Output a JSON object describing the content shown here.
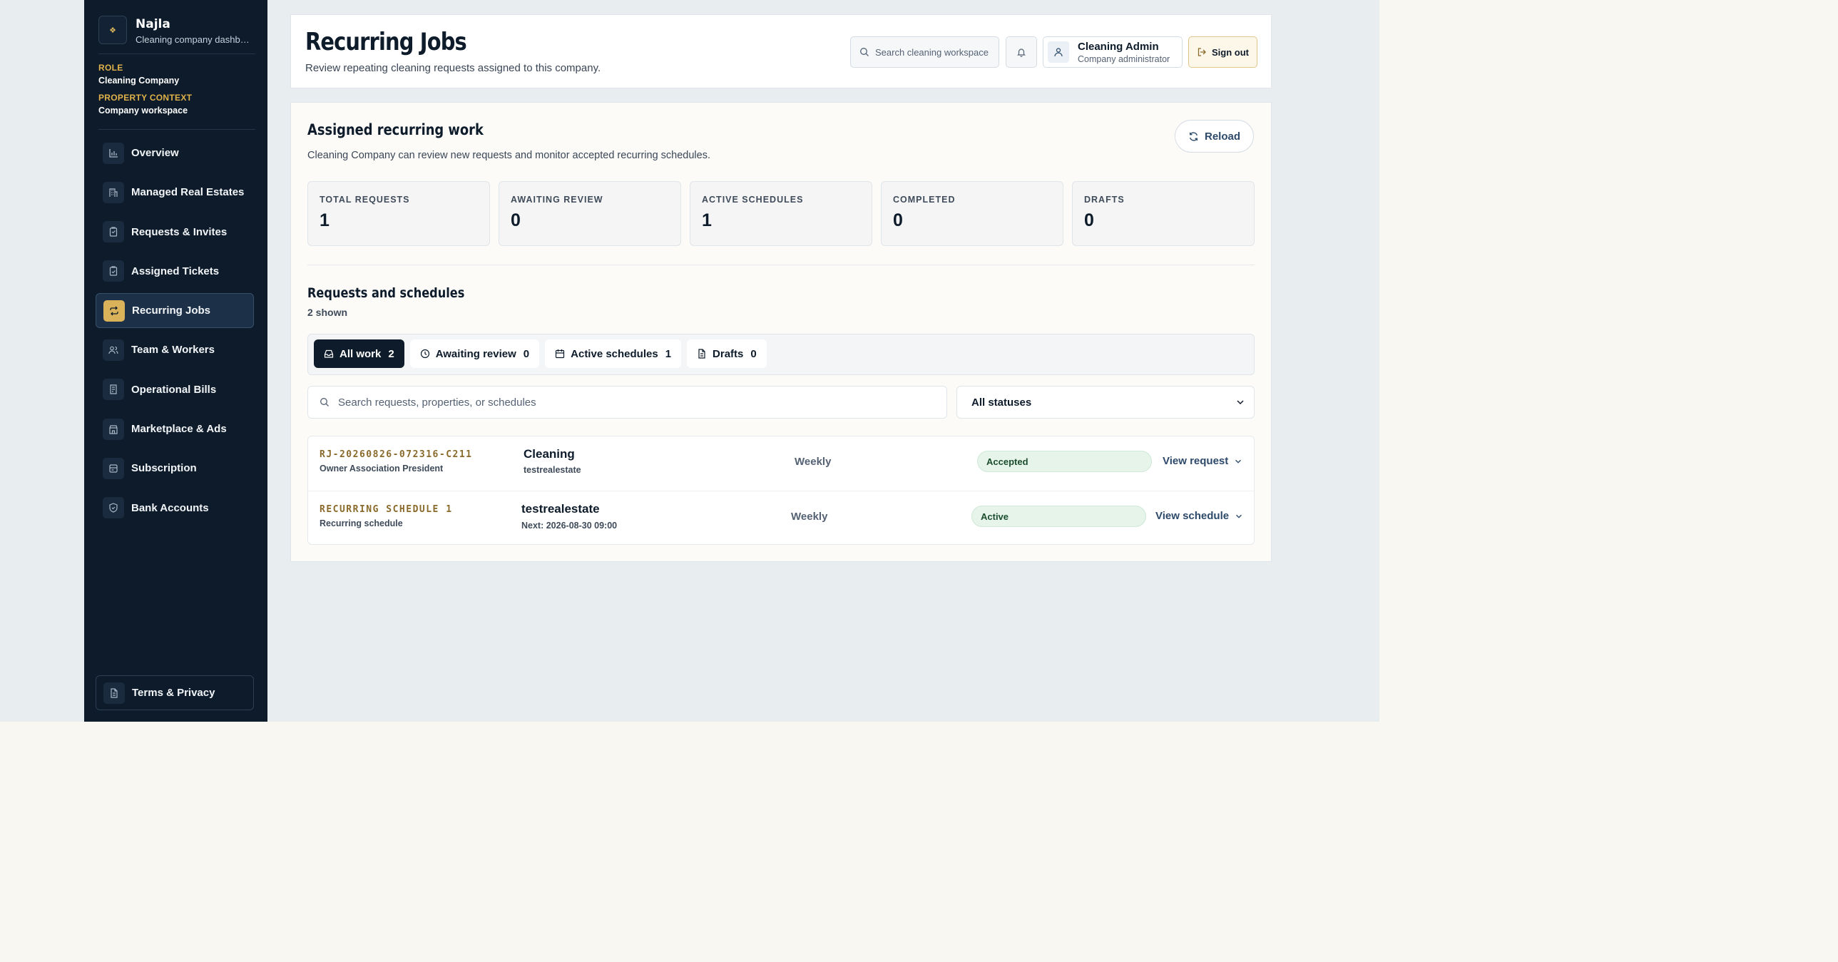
{
  "brand": {
    "name": "Najla",
    "subtitle": "Cleaning company dashboard"
  },
  "context": {
    "role_label": "ROLE",
    "role_value": "Cleaning Company",
    "property_label": "PROPERTY CONTEXT",
    "property_value": "Company workspace"
  },
  "sidebar": {
    "items": [
      {
        "label": "Overview",
        "icon": "bar-chart-icon"
      },
      {
        "label": "Managed Real Estates",
        "icon": "building-icon"
      },
      {
        "label": "Requests & Invites",
        "icon": "clipboard-icon"
      },
      {
        "label": "Assigned Tickets",
        "icon": "clipboard-check-icon"
      },
      {
        "label": "Recurring Jobs",
        "icon": "repeat-icon",
        "active": true
      },
      {
        "label": "Team & Workers",
        "icon": "users-icon"
      },
      {
        "label": "Operational Bills",
        "icon": "receipt-icon"
      },
      {
        "label": "Marketplace & Ads",
        "icon": "store-icon"
      },
      {
        "label": "Subscription",
        "icon": "card-icon"
      },
      {
        "label": "Bank Accounts",
        "icon": "shield-icon"
      }
    ],
    "terms_label": "Terms & Privacy"
  },
  "header": {
    "title": "Recurring Jobs",
    "subtitle": "Review repeating cleaning requests assigned to this company.",
    "search_placeholder": "Search cleaning workspace",
    "user_name": "Cleaning Admin",
    "user_role": "Company administrator",
    "signout_label": "Sign out"
  },
  "main": {
    "title": "Assigned recurring work",
    "subtitle": "Cleaning Company can review new requests and monitor accepted recurring schedules.",
    "reload_label": "Reload",
    "stats": [
      {
        "label": "TOTAL REQUESTS",
        "value": "1"
      },
      {
        "label": "AWAITING REVIEW",
        "value": "0"
      },
      {
        "label": "ACTIVE SCHEDULES",
        "value": "1"
      },
      {
        "label": "COMPLETED",
        "value": "0"
      },
      {
        "label": "DRAFTS",
        "value": "0"
      }
    ],
    "list_title": "Requests and schedules",
    "list_count": "2 shown",
    "tabs": [
      {
        "label": "All work",
        "count": "2"
      },
      {
        "label": "Awaiting review",
        "count": "0"
      },
      {
        "label": "Active schedules",
        "count": "1"
      },
      {
        "label": "Drafts",
        "count": "0"
      }
    ],
    "search_placeholder": "Search requests, properties, or schedules",
    "status_filter": "All statuses",
    "rows": [
      {
        "ref": "RJ-20260826-072316-C211",
        "ref_sub": "Owner Association President",
        "title": "Cleaning",
        "title_sub": "testrealestate",
        "frequency": "Weekly",
        "status": "Accepted",
        "action": "View request"
      },
      {
        "ref": "RECURRING SCHEDULE 1",
        "ref_sub": "Recurring schedule",
        "title": "testrealestate",
        "title_sub": "Next: 2026-08-30 09:00",
        "frequency": "Weekly",
        "status": "Active",
        "action": "View schedule"
      }
    ]
  }
}
